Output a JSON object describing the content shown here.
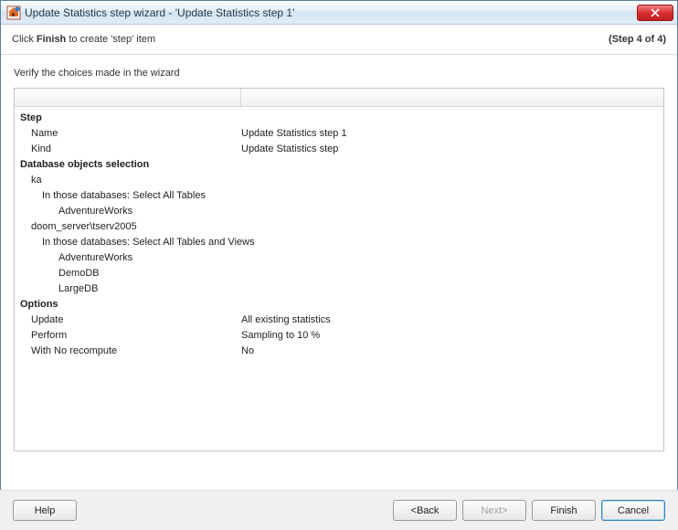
{
  "window": {
    "title": "Update Statistics step wizard - 'Update Statistics step 1'"
  },
  "header": {
    "prefix": "Click ",
    "bold": "Finish",
    "suffix": " to create 'step' item",
    "step_counter": "(Step 4 of 4)"
  },
  "verify_text": "Verify the choices made in the wizard",
  "summary": {
    "step": {
      "heading": "Step",
      "name_label": "Name",
      "name_value": "Update Statistics step 1",
      "kind_label": "Kind",
      "kind_value": "Update Statistics step"
    },
    "dbsel": {
      "heading": "Database objects selection",
      "servers": [
        {
          "name": "ka",
          "scope": "In those databases: Select All Tables",
          "dbs": [
            "AdventureWorks"
          ]
        },
        {
          "name": "doom_server\\tserv2005",
          "scope": "In those databases: Select All Tables and Views",
          "dbs": [
            "AdventureWorks",
            "DemoDB",
            "LargeDB"
          ]
        }
      ]
    },
    "options": {
      "heading": "Options",
      "update_label": "Update",
      "update_value": "All existing statistics",
      "perform_label": "Perform",
      "perform_value": "Sampling to 10 %",
      "norecompute_label": "With No recompute",
      "norecompute_value": "No"
    }
  },
  "buttons": {
    "help": "Help",
    "back": "<Back",
    "next": "Next>",
    "finish": "Finish",
    "cancel": "Cancel"
  }
}
